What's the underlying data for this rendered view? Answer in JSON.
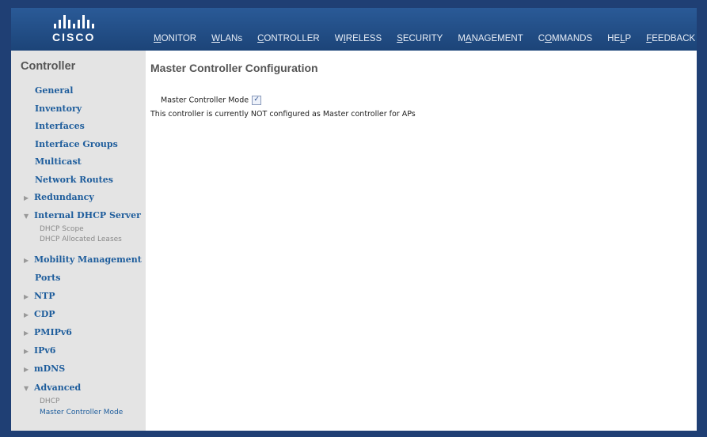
{
  "brand": {
    "logo_text": "CISCO"
  },
  "menu": [
    {
      "pre": "",
      "ul": "M",
      "post": "ONITOR",
      "name": "monitor"
    },
    {
      "pre": "",
      "ul": "W",
      "post": "LANs",
      "name": "wlans"
    },
    {
      "pre": "",
      "ul": "C",
      "post": "ONTROLLER",
      "name": "controller"
    },
    {
      "pre": "W",
      "ul": "I",
      "post": "RELESS",
      "name": "wireless"
    },
    {
      "pre": "",
      "ul": "S",
      "post": "ECURITY",
      "name": "security"
    },
    {
      "pre": "M",
      "ul": "A",
      "post": "NAGEMENT",
      "name": "management"
    },
    {
      "pre": "C",
      "ul": "O",
      "post": "MMANDS",
      "name": "commands"
    },
    {
      "pre": "HE",
      "ul": "L",
      "post": "P",
      "name": "help"
    },
    {
      "pre": "",
      "ul": "F",
      "post": "EEDBACK",
      "name": "feedback"
    }
  ],
  "sidebar": {
    "title": "Controller",
    "items": [
      {
        "label": "General",
        "arrow": ""
      },
      {
        "label": "Inventory",
        "arrow": ""
      },
      {
        "label": "Interfaces",
        "arrow": ""
      },
      {
        "label": "Interface Groups",
        "arrow": ""
      },
      {
        "label": "Multicast",
        "arrow": ""
      },
      {
        "label": "Network Routes",
        "arrow": ""
      },
      {
        "label": "Redundancy",
        "arrow": "right"
      },
      {
        "label": "Internal DHCP Server",
        "arrow": "down"
      },
      {
        "label": "Mobility Management",
        "arrow": "right"
      },
      {
        "label": "Ports",
        "arrow": ""
      },
      {
        "label": "NTP",
        "arrow": "right"
      },
      {
        "label": "CDP",
        "arrow": "right"
      },
      {
        "label": "PMIPv6",
        "arrow": "right"
      },
      {
        "label": "IPv6",
        "arrow": "right"
      },
      {
        "label": "mDNS",
        "arrow": "right"
      },
      {
        "label": "Advanced",
        "arrow": "down"
      }
    ],
    "dhcp_sub": [
      "DHCP Scope",
      "DHCP Allocated Leases"
    ],
    "advanced_sub": [
      "DHCP",
      "Master Controller Mode"
    ]
  },
  "main": {
    "title": "Master Controller Configuration",
    "field_label": "Master Controller Mode",
    "checkbox_checked": true,
    "status_text": "This controller is currently NOT configured as Master controller for APs"
  }
}
